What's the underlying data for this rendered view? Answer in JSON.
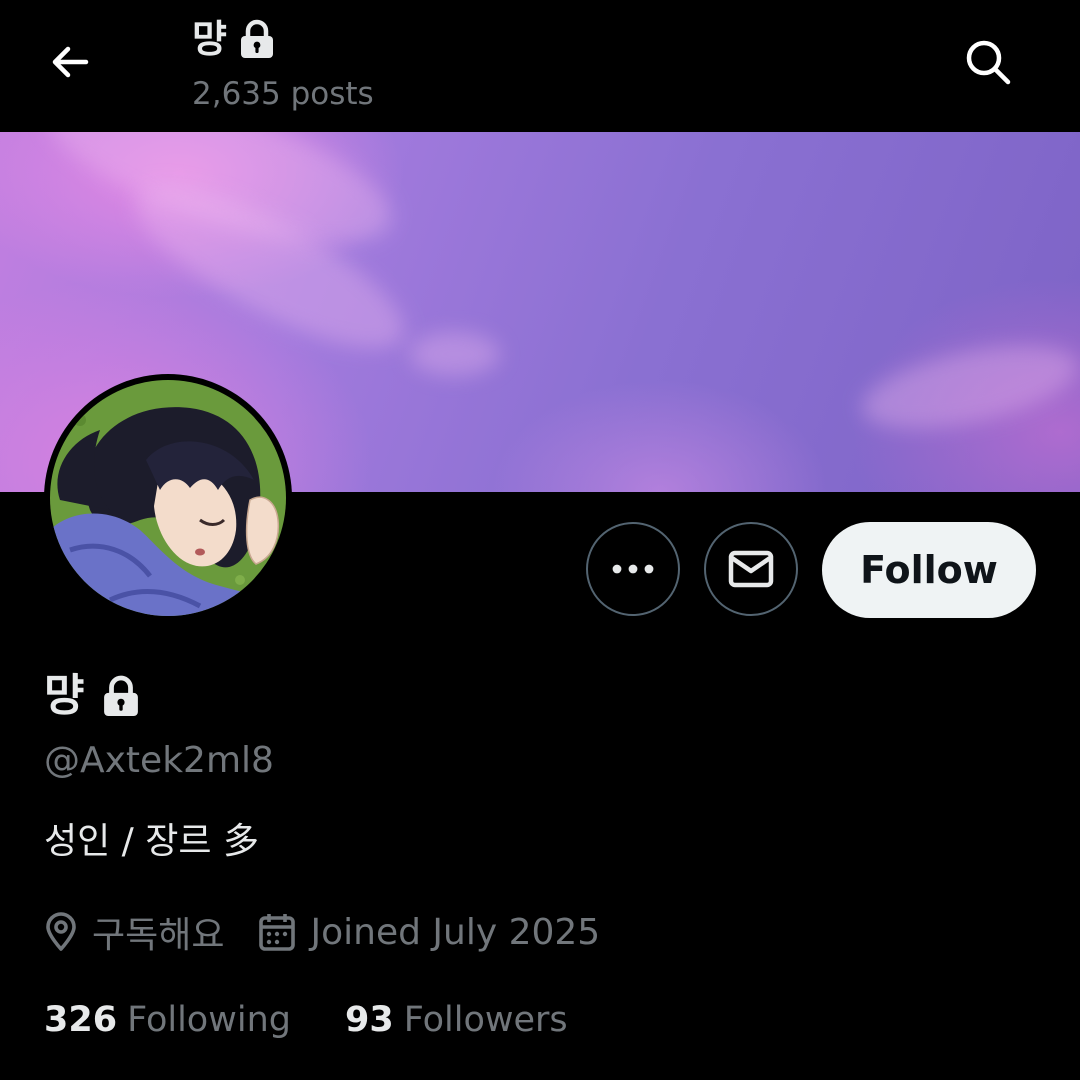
{
  "header": {
    "display_name": "먕",
    "post_count": "2,635 posts",
    "back_icon": "back-arrow-icon",
    "search_icon": "search-icon",
    "lock_icon": "lock-icon"
  },
  "banner": {
    "type": "sky-photo"
  },
  "avatar": {
    "type": "anime-character-illustration"
  },
  "actions": {
    "more_icon": "more-options-icon",
    "message_icon": "envelope-icon",
    "follow_label": "Follow"
  },
  "profile": {
    "display_name": "먕",
    "handle": "@Axtek2ml8",
    "bio": "성인 / 장르 多",
    "location": "구독해요",
    "joined": "Joined July 2025",
    "following_count": "326",
    "following_label": "Following",
    "followers_count": "93",
    "followers_label": "Followers"
  },
  "colors": {
    "background": "#000000",
    "primary_text": "#e7e9ea",
    "secondary_text": "#71767b",
    "follow_button_bg": "#eff3f4",
    "follow_button_text": "#0f1419",
    "outline_button_border": "#536471"
  }
}
